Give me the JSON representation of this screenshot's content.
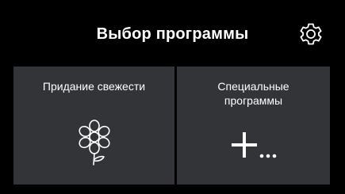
{
  "header": {
    "title": "Выбор программы",
    "settings_icon": "gear-icon"
  },
  "tiles": [
    {
      "label": "Придание свежести",
      "icon": "flower-icon"
    },
    {
      "label": "Специальные программы",
      "icon": "plus-more-icon"
    }
  ],
  "colors": {
    "background": "#000000",
    "tile": "#323437",
    "text": "#ffffff"
  }
}
